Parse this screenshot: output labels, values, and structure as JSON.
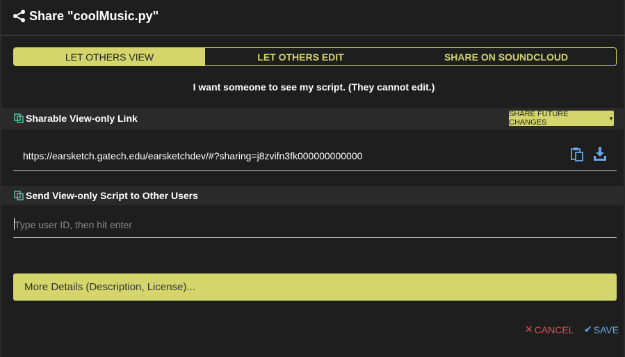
{
  "header": {
    "title": "Share \"coolMusic.py\"",
    "icon": "share-icon"
  },
  "tabs": [
    {
      "label": "LET OTHERS VIEW",
      "active": true
    },
    {
      "label": "LET OTHERS EDIT",
      "active": false
    },
    {
      "label": "SHARE ON SOUNDCLOUD",
      "active": false
    }
  ],
  "description": "I want someone to see my script. (They cannot edit.)",
  "link_section": {
    "label": "Sharable View-only Link",
    "future_button": "SHARE FUTURE CHANGES",
    "url": "https://earsketch.gatech.edu/earsketchdev/#?sharing=j8zvifn3fk000000000000"
  },
  "send_section": {
    "label": "Send View-only Script to Other Users",
    "placeholder": "Type user ID, then hit enter",
    "value": ""
  },
  "more_details": "More Details (Description, License)...",
  "footer": {
    "cancel": "CANCEL",
    "save": "SAVE"
  },
  "colors": {
    "accent": "#d4d56b",
    "cancel": "#d9534f",
    "save": "#6aa6e8",
    "icon_green": "#4fc3a1",
    "icon_blue": "#6aa6e8"
  }
}
